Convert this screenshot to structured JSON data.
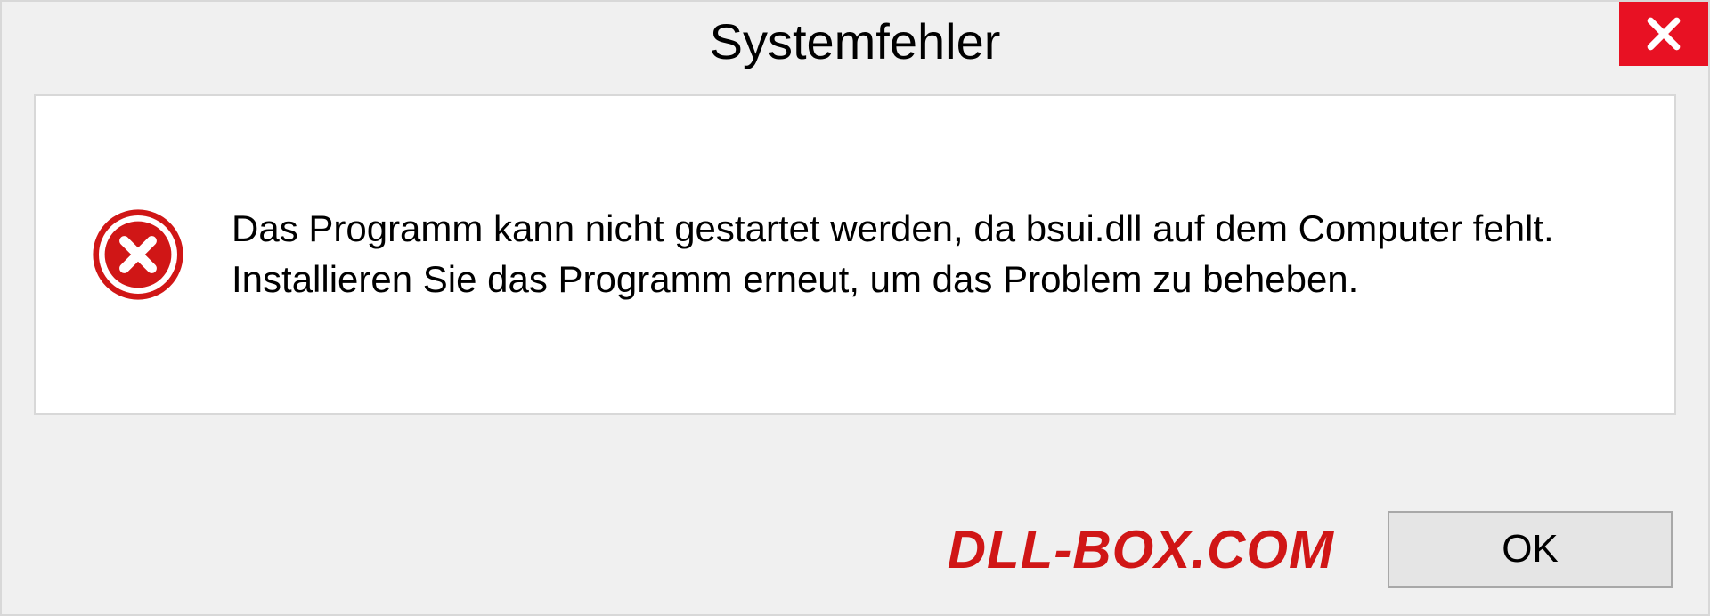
{
  "dialog": {
    "title": "Systemfehler",
    "message": "Das Programm kann nicht gestartet werden, da bsui.dll auf dem Computer fehlt. Installieren Sie das Programm erneut, um das Problem zu beheben.",
    "ok_label": "OK"
  },
  "watermark": "DLL-BOX.COM"
}
